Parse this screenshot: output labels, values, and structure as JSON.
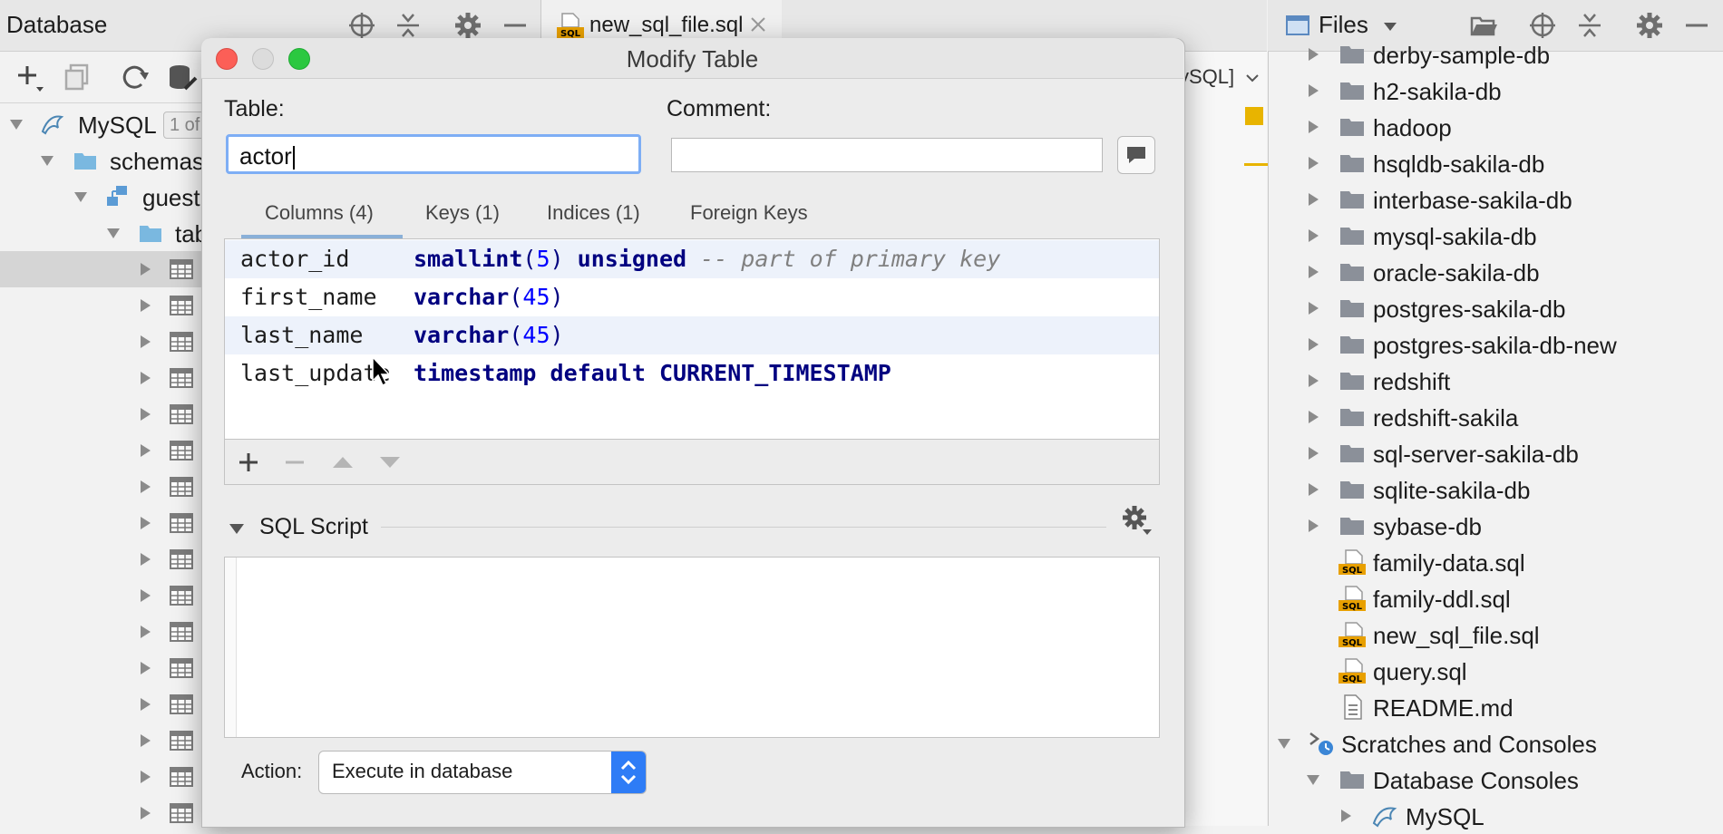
{
  "db_pane": {
    "title": "Database",
    "tree": {
      "root": {
        "label": "MySQL",
        "badge": "1 of"
      },
      "schemas": "schemas",
      "schema": "guest",
      "tables_folder": "tab"
    },
    "table_rows_count": 16
  },
  "editor": {
    "tab_label": "new_sql_file.sql",
    "toolbar_right": "ySQL]"
  },
  "files_pane": {
    "title": "Files",
    "items": [
      {
        "label": "derby-sample-db",
        "type": "folder"
      },
      {
        "label": "h2-sakila-db",
        "type": "folder"
      },
      {
        "label": "hadoop",
        "type": "folder"
      },
      {
        "label": "hsqldb-sakila-db",
        "type": "folder"
      },
      {
        "label": "interbase-sakila-db",
        "type": "folder"
      },
      {
        "label": "mysql-sakila-db",
        "type": "folder"
      },
      {
        "label": "oracle-sakila-db",
        "type": "folder"
      },
      {
        "label": "postgres-sakila-db",
        "type": "folder"
      },
      {
        "label": "postgres-sakila-db-new",
        "type": "folder"
      },
      {
        "label": "redshift",
        "type": "folder"
      },
      {
        "label": "redshift-sakila",
        "type": "folder"
      },
      {
        "label": "sql-server-sakila-db",
        "type": "folder"
      },
      {
        "label": "sqlite-sakila-db",
        "type": "folder"
      },
      {
        "label": "sybase-db",
        "type": "folder"
      },
      {
        "label": "family-data.sql",
        "type": "sql"
      },
      {
        "label": "family-ddl.sql",
        "type": "sql"
      },
      {
        "label": "new_sql_file.sql",
        "type": "sql"
      },
      {
        "label": "query.sql",
        "type": "sql"
      },
      {
        "label": "README.md",
        "type": "md"
      },
      {
        "label": "Scratches and Consoles",
        "type": "scratches"
      },
      {
        "label": "Database Consoles",
        "type": "folder-open"
      },
      {
        "label": "MySQL",
        "type": "mysql"
      }
    ]
  },
  "dialog": {
    "title": "Modify Table",
    "table_label": "Table:",
    "table_value": "actor",
    "comment_label": "Comment:",
    "comment_value": "",
    "tabs": [
      "Columns (4)",
      "Keys (1)",
      "Indices (1)",
      "Foreign Keys"
    ],
    "active_tab": "Columns (4)",
    "columns": [
      {
        "name": "actor_id",
        "type": "smallint",
        "size": "5",
        "extra": "unsigned",
        "comment": "-- part of primary key"
      },
      {
        "name": "first_name",
        "type": "varchar",
        "size": "45",
        "extra": "",
        "comment": ""
      },
      {
        "name": "last_name",
        "type": "varchar",
        "size": "45",
        "extra": "",
        "comment": ""
      },
      {
        "name": "last_update",
        "type": "timestamp",
        "size": "",
        "extra": "default CURRENT_TIMESTAMP",
        "comment": ""
      }
    ],
    "sql_section_label": "SQL Script",
    "sql_script": "",
    "action_label": "Action:",
    "action_value": "Execute in database"
  },
  "colors": {
    "accent": "#2e7cf6",
    "focus_ring": "#7eaef5",
    "keyword": "#000080",
    "number": "#0000ff",
    "comment": "#808080",
    "folder": "#8b9099",
    "traffic_red": "#fc5f57",
    "traffic_yellow": "#dcdcdc",
    "traffic_green": "#2bc840"
  }
}
